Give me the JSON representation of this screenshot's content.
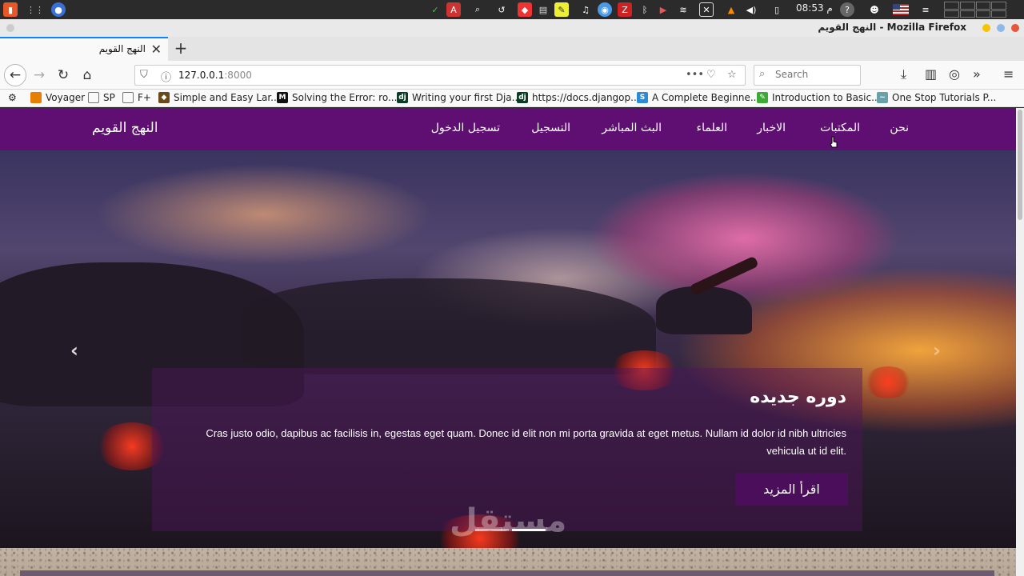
{
  "taskbar": {
    "clock": "08:53 م",
    "icons": [
      "app-menu-icon",
      "grid-icon",
      "firefox-icon",
      "checkmark-icon",
      "dictionary-icon",
      "search-icon",
      "history-icon",
      "git-icon",
      "books-icon",
      "notes-icon",
      "headphones-icon",
      "chrome-icon",
      "zotero-icon",
      "bluetooth-icon",
      "camera-icon",
      "wifi-icon",
      "x-icon",
      "vlc-icon",
      "volume-icon",
      "battery-icon",
      "help-icon",
      "user-icon",
      "flag-icon",
      "menu-icon"
    ]
  },
  "window": {
    "title": "النهج القويم - Mozilla Firefox"
  },
  "tabs": [
    {
      "label": "النهج القويم",
      "active": true
    }
  ],
  "urlbar": {
    "host": "127.0.0.1",
    "port": ":8000"
  },
  "search": {
    "placeholder": "Search"
  },
  "bookmarks": [
    {
      "label": "Voyager",
      "icon": "folder-orange-icon",
      "color": "#e67e00"
    },
    {
      "label": "SP",
      "icon": "folder-icon",
      "color": "#777777"
    },
    {
      "label": "F+",
      "icon": "folder-icon",
      "color": "#777777"
    },
    {
      "label": "Simple and Easy Lar...",
      "icon": "laravel-icon",
      "color": "#6b4a1a"
    },
    {
      "label": "Solving the Error: ro...",
      "icon": "medium-icon",
      "color": "#111111"
    },
    {
      "label": "Writing your first Dja...",
      "icon": "django-icon",
      "color": "#0c3c26"
    },
    {
      "label": "https://docs.djangop...",
      "icon": "django-icon",
      "color": "#0c3c26"
    },
    {
      "label": "A Complete Beginne...",
      "icon": "s-icon",
      "color": "#2b8bd6"
    },
    {
      "label": "Introduction to Basic...",
      "icon": "green-icon",
      "color": "#3daa36"
    },
    {
      "label": "One Stop Tutorials P...",
      "icon": "tutorial-icon",
      "color": "#6aa0a8"
    }
  ],
  "site": {
    "brand": "النهج القويم",
    "menu": [
      "نحن",
      "المكتبات",
      "الاخبار",
      "العلماء",
      "البث المباشر",
      "التسجيل",
      "تسجيل الدخول"
    ],
    "nav_color": "#5f0f72"
  },
  "hero": {
    "title": "دوره جديده",
    "text": "Cras justo odio, dapibus ac facilisis in, egestas eget quam. Donec id elit non mi porta gravida at eget metus. Nullam id dolor id nibh ultricies vehicula ut id elit.",
    "button": "اقرأ المزيد",
    "prev_arrow": "‹",
    "next_arrow": "›",
    "watermark": "مستقل"
  }
}
